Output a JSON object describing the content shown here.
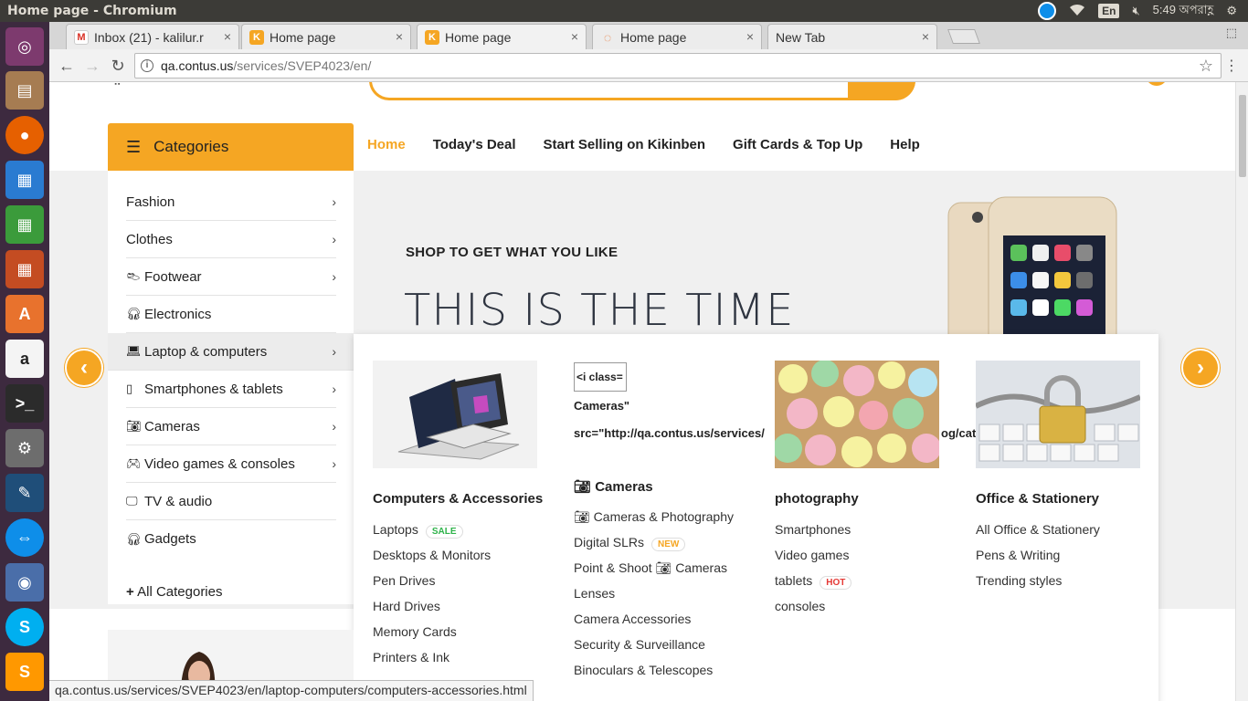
{
  "os": {
    "window_title": "Home page - Chromium",
    "clock": "5:49 অপরাহ্ণ",
    "lang": "En"
  },
  "tabs": [
    {
      "label": "Inbox (21) - kalilur.r"
    },
    {
      "label": "Home page"
    },
    {
      "label": "Home page"
    },
    {
      "label": "Home page"
    },
    {
      "label": "New Tab"
    }
  ],
  "address": {
    "host": "qa.contus.us",
    "path": "/services/SVEP4023/en/"
  },
  "categories_header": "Categories",
  "topnav": [
    "Home",
    "Today's Deal",
    "Start Selling on Kikinben",
    "Gift Cards & Top Up",
    "Help"
  ],
  "categories": [
    {
      "label": "Fashion"
    },
    {
      "label": "Clothes"
    },
    {
      "label": "Footwear"
    },
    {
      "label": "Electronics"
    },
    {
      "label": "Laptop & computers"
    },
    {
      "label": "Smartphones & tablets"
    },
    {
      "label": "Cameras"
    },
    {
      "label": "Video games & consoles"
    },
    {
      "label": "TV & audio"
    },
    {
      "label": "Gadgets"
    }
  ],
  "all_categories": "All Categories",
  "hero": {
    "subtitle": "SHOP TO GET WHAT YOU LIKE",
    "title": "THIS IS THE TIME"
  },
  "mega": {
    "col1": {
      "heading": "Computers & Accessories",
      "links": [
        "Laptops",
        "Desktops & Monitors",
        "Pen Drives",
        "Hard Drives",
        "Memory Cards",
        "Printers & Ink"
      ],
      "badge_sale": "SALE"
    },
    "col2": {
      "broken_img": "<i class=",
      "raw1": "Cameras\"",
      "raw2": "src=\"http://qa.contus.us/services/",
      "heading": "Cameras",
      "links": [
        "Cameras & Photography",
        "Digital SLRs",
        "Point & Shoot",
        "Cameras",
        "Lenses",
        "Camera Accessories",
        "Security & Surveillance",
        "Binoculars & Telescopes"
      ],
      "badge_new": "NEW"
    },
    "col3": {
      "heading": "photography",
      "links": [
        "Smartphones",
        "Video games",
        "tablets",
        "consoles"
      ],
      "badge_hot": "HOT",
      "overflow_text": "og/cate"
    },
    "col4": {
      "heading": "Office & Stationery",
      "links": [
        "All Office & Stationery",
        "Pens & Writing",
        "Trending styles"
      ]
    }
  },
  "status_url": "qa.contus.us/services/SVEP4023/en/laptop-computers/computers-accessories.html",
  "colors": {
    "accent": "#f5a623",
    "launcher": "#3d2a3f"
  }
}
